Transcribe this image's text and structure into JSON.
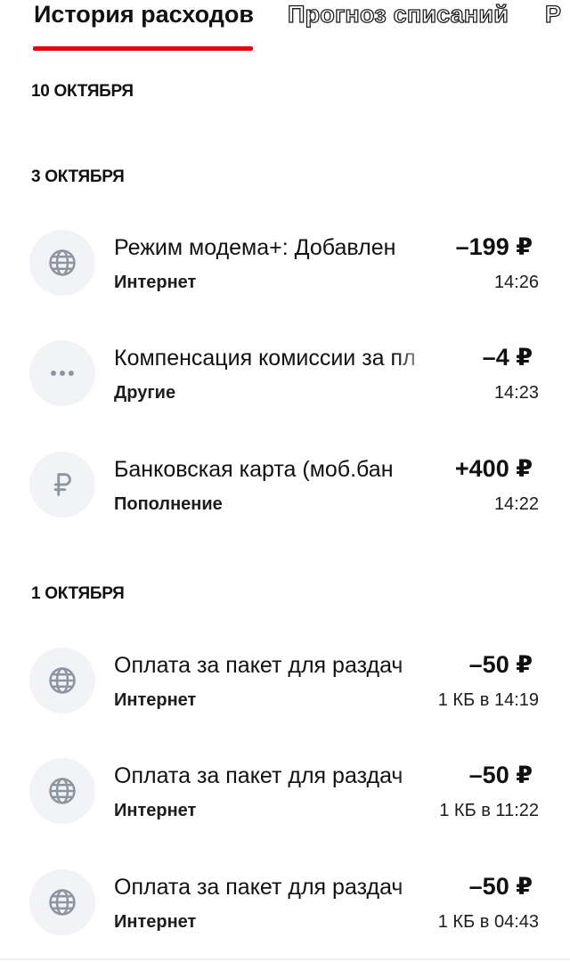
{
  "tabs": [
    {
      "label": "История расходов",
      "active": true
    },
    {
      "label": "Прогноз списаний",
      "active": false
    },
    {
      "label": "Р",
      "active": false
    }
  ],
  "colors": {
    "accent": "#e30611",
    "icon_bg": "#f2f3f7",
    "icon_fg": "#8d969f"
  },
  "groups": [
    {
      "date": "10 ОКТЯБРЯ",
      "items": []
    },
    {
      "date": "3 ОКТЯБРЯ",
      "items": [
        {
          "icon": "globe-icon",
          "title": "Режим модема+: Добавлен",
          "amount": "–199 ₽",
          "category": "Интернет",
          "meta": "14:26"
        },
        {
          "icon": "more-dots-icon",
          "title": "Компенсация комиссии за пл",
          "amount": "–4 ₽",
          "category": "Другие",
          "meta": "14:23"
        },
        {
          "icon": "ruble-icon",
          "title": "Банковская карта (моб.бан",
          "amount": "+400 ₽",
          "category": "Пополнение",
          "meta": "14:22"
        }
      ]
    },
    {
      "date": "1 ОКТЯБРЯ",
      "items": [
        {
          "icon": "globe-icon",
          "title": "Оплата за пакет для раздач",
          "amount": "–50 ₽",
          "category": "Интернет",
          "meta": "1 КБ в 14:19"
        },
        {
          "icon": "globe-icon",
          "title": "Оплата за пакет для раздач",
          "amount": "–50 ₽",
          "category": "Интернет",
          "meta": "1 КБ в 11:22"
        },
        {
          "icon": "globe-icon",
          "title": "Оплата за пакет для раздач",
          "amount": "–50 ₽",
          "category": "Интернет",
          "meta": "1 КБ в 04:43"
        }
      ]
    }
  ]
}
